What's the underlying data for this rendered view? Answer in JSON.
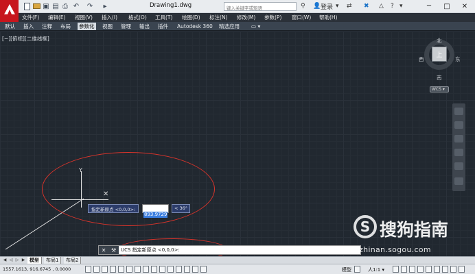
{
  "window": {
    "title": "Drawing1.dwg",
    "search_placeholder": "键入关键字或短语",
    "login_label": "登录",
    "minimize_glyph": "─",
    "restore_glyph": "□",
    "close_glyph": "✕"
  },
  "menu": [
    {
      "label": "文件(F)"
    },
    {
      "label": "编辑(E)"
    },
    {
      "label": "视图(V)"
    },
    {
      "label": "插入(I)"
    },
    {
      "label": "格式(O)"
    },
    {
      "label": "工具(T)"
    },
    {
      "label": "绘图(D)"
    },
    {
      "label": "标注(N)"
    },
    {
      "label": "修改(M)"
    },
    {
      "label": "参数(P)"
    },
    {
      "label": "窗口(W)"
    },
    {
      "label": "帮助(H)"
    }
  ],
  "ribbon_tabs": [
    {
      "label": "默认"
    },
    {
      "label": "插入"
    },
    {
      "label": "注释"
    },
    {
      "label": "布局"
    },
    {
      "label": "参数化",
      "active": true
    },
    {
      "label": "视图"
    },
    {
      "label": "管理"
    },
    {
      "label": "输出"
    },
    {
      "label": "插件"
    },
    {
      "label": "Autodesk 360"
    },
    {
      "label": "精选应用"
    },
    {
      "label": "▭ ▾"
    }
  ],
  "viewport": {
    "label": "[−][俯视][二维线框]"
  },
  "viewcube": {
    "north": "北",
    "south": "南",
    "east": "东",
    "west": "西",
    "top": "上",
    "wcs": "WCS ▾"
  },
  "ucs_icon": {
    "y_label": "Y",
    "x_mark": "✕"
  },
  "dynamic_input": {
    "prompt": "指定新原点 <0,0,0>:",
    "value": "893.9729",
    "angle": "< 36°"
  },
  "command_line": {
    "close_glyph": "✕",
    "wrench_glyph": "🔧",
    "text": "UCS 指定新原点 <0,0,0>:"
  },
  "watermark": {
    "logo_char": "S",
    "brand": "搜狗指南",
    "url": "zhinan.sogou.com"
  },
  "layout_tabs": [
    {
      "label": "模型",
      "active": true
    },
    {
      "label": "布局1"
    },
    {
      "label": "布局2"
    }
  ],
  "status": {
    "coordinates": "1557.1613, 916.6745 , 0.0000",
    "model_label": "模型",
    "scale_label": "人1:1 ▾"
  },
  "colors": {
    "accent_red": "#c7161d",
    "annotation_red": "#d9342b",
    "canvas_bg": "#212830",
    "selection_blue": "#3b7ee0"
  }
}
